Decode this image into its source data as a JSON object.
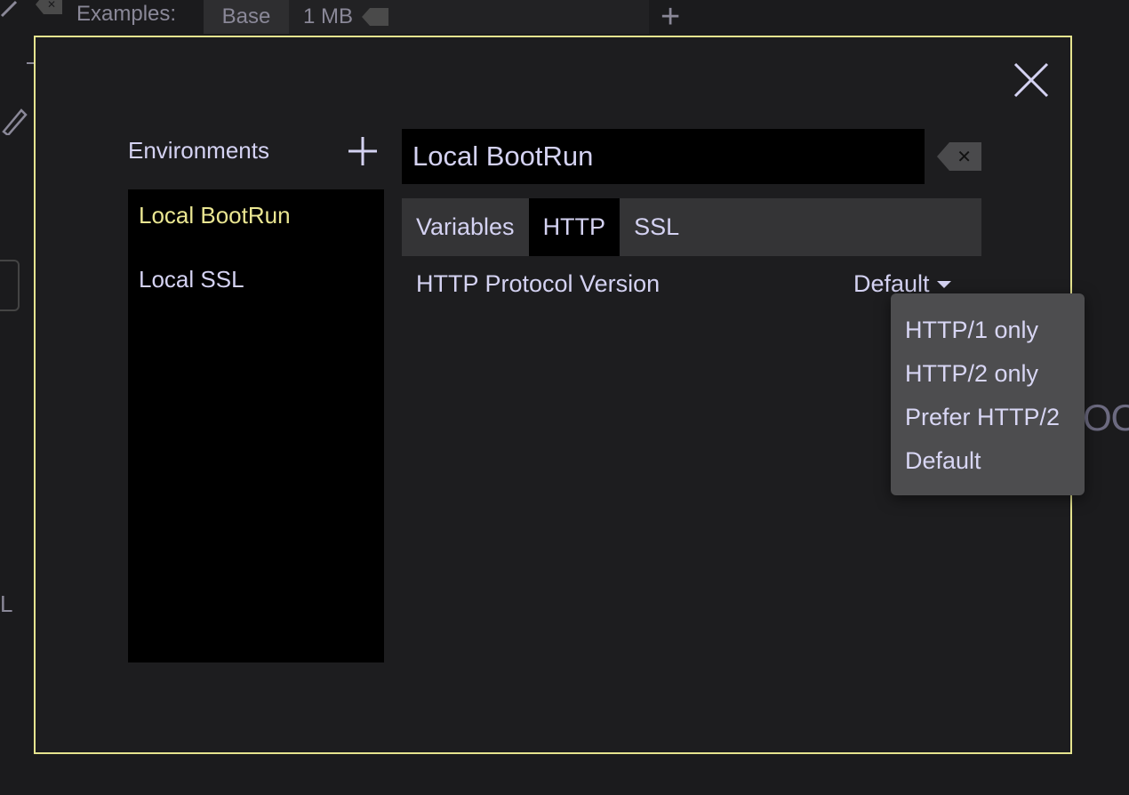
{
  "background": {
    "examples_label": "Examples:",
    "tab_base": "Base",
    "tab_size": "1 MB",
    "small_delete_glyph": "✕",
    "add_tab_glyph": "+",
    "left_edge_letter": "L",
    "right_partial_text": "OO"
  },
  "modal": {
    "environments_title": "Environments",
    "environments": [
      {
        "label": "Local BootRun",
        "active": true
      },
      {
        "label": "Local SSL",
        "active": false
      }
    ],
    "name_value": "Local BootRun",
    "clear_glyph": "✕",
    "tabs": [
      {
        "label": "Variables",
        "active": false
      },
      {
        "label": "HTTP",
        "active": true
      },
      {
        "label": "SSL",
        "active": false
      }
    ],
    "http_protocol_label": "HTTP Protocol Version",
    "http_protocol_value": "Default",
    "dropdown_options": [
      "HTTP/1 only",
      "HTTP/2 only",
      "Prefer HTTP/2",
      "Default"
    ]
  },
  "colors": {
    "modal_border": "#e6e48f",
    "active_env": "#eae692",
    "text": "#d4d2f2",
    "panel_black": "#000000",
    "dropdown_bg": "#4d4d4f"
  }
}
